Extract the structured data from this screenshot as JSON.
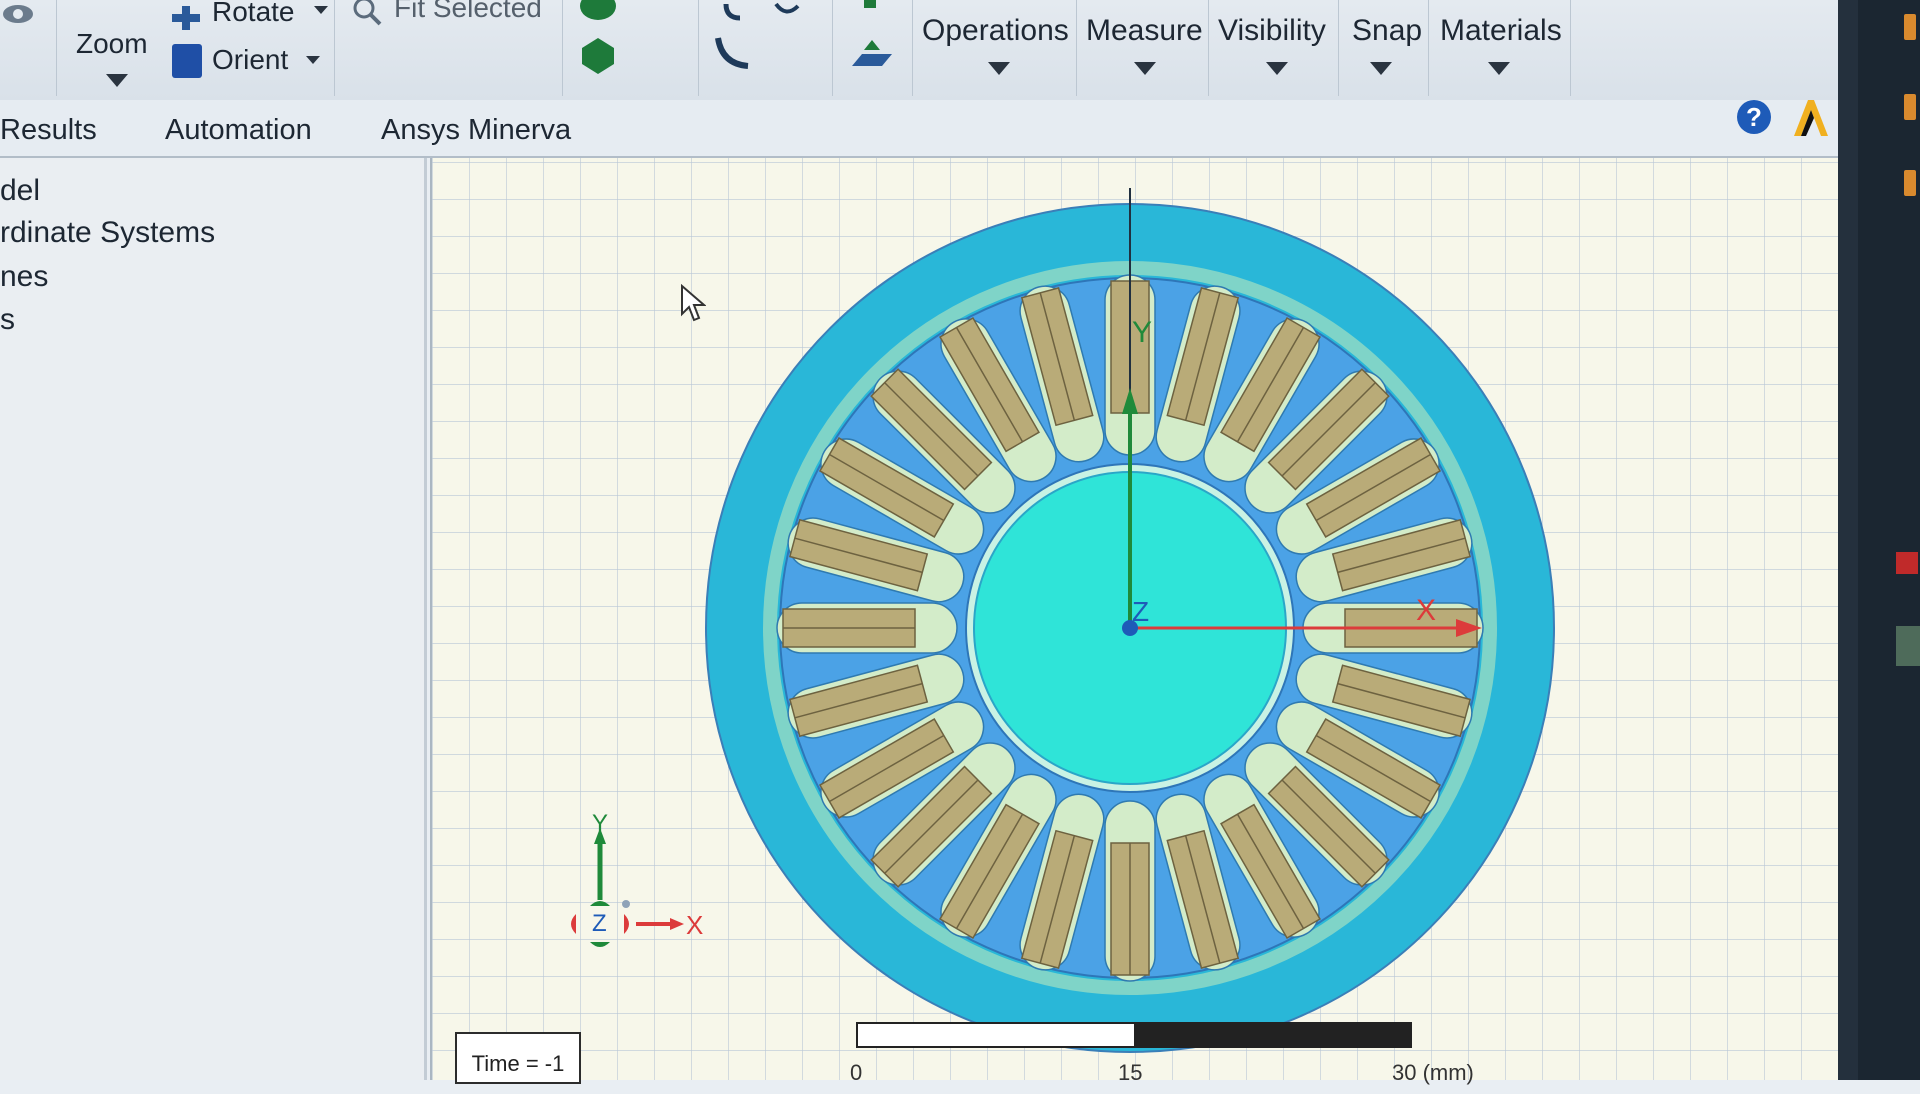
{
  "ribbon": {
    "zoom_label": "Zoom",
    "rotate_label": "Rotate",
    "orient_label": "Orient",
    "fit_selected_label": "Fit Selected",
    "menus": [
      "Operations",
      "Measure",
      "Visibility",
      "Snap",
      "Materials"
    ]
  },
  "tabs": [
    "Results",
    "Automation",
    "Ansys Minerva"
  ],
  "tree": {
    "items": [
      "del",
      "rdinate Systems",
      "nes",
      "s"
    ]
  },
  "viewport": {
    "axes": {
      "y": "Y",
      "z": "Z",
      "x": "X"
    },
    "triad": {
      "y": "Y",
      "z": "Z",
      "x": "X"
    },
    "time_label": "Time = -1",
    "scale": {
      "start": "0",
      "mid": "15",
      "end": "30 (mm)"
    }
  },
  "colors": {
    "stator_outer": "#29b7d8",
    "stator_inner": "#4ba2e6",
    "rotor": "#2fe4d8",
    "coil": "#b9ab78",
    "slot": "#d3ecc9",
    "x_axis": "#dc3b3b",
    "y_axis": "#1f8a3a"
  },
  "icons": [
    "eye-icon",
    "rotate-icon",
    "orient-icon",
    "fit-selected-icon",
    "help-icon",
    "ansys-logo"
  ]
}
